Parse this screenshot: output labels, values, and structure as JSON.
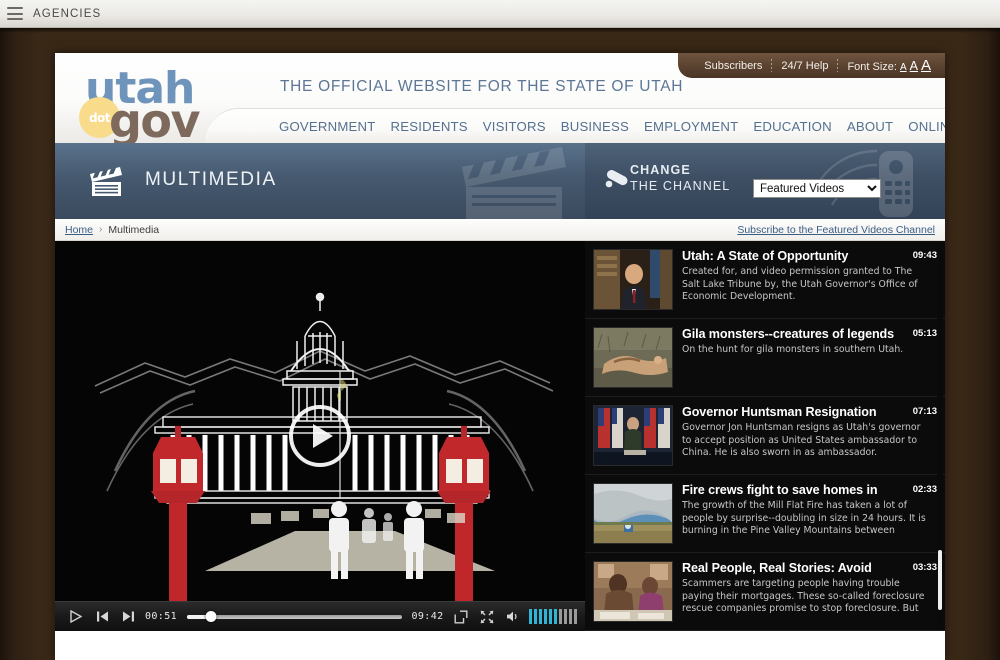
{
  "os_bar": {
    "menu_icon": "hamburger-icon",
    "agencies_label": "AGENCIES"
  },
  "header": {
    "logo": {
      "word1": "utah",
      "dot": "dot",
      "word2": "gov"
    },
    "tagline": "THE OFFICIAL WEBSITE FOR THE STATE OF UTAH",
    "utility": {
      "subscribers": "Subscribers",
      "help": "24/7 Help",
      "font_size_label": "Font Size:",
      "font_size_small": "A",
      "font_size_medium": "A",
      "font_size_large": "A"
    },
    "nav": [
      "GOVERNMENT",
      "RESIDENTS",
      "VISITORS",
      "BUSINESS",
      "EMPLOYMENT",
      "EDUCATION",
      "ABOUT",
      "ONLINE SERVICES"
    ]
  },
  "banner": {
    "section_icon": "clapperboard-icon",
    "section_title": "MULTIMEDIA",
    "channel_icon": "remote-control-icon",
    "channel_line1": "CHANGE",
    "channel_line2": "THE CHANNEL",
    "channel_selected": "Featured Videos",
    "channel_options": [
      "Featured Videos"
    ]
  },
  "breadcrumb": {
    "home": "Home",
    "separator": "›",
    "current": "Multimedia",
    "subscribe_link": "Subscribe to the Featured Videos Channel"
  },
  "player": {
    "poster_description": "Animated white line-art of the Utah State Capitol on black with red lamp posts and white figures",
    "play_icon": "play-icon",
    "controls": {
      "play": "play-icon",
      "previous": "previous-track-icon",
      "next": "next-track-icon",
      "current_time": "00:51",
      "total_time": "09:42",
      "progress_percent": 11,
      "popout": "popout-icon",
      "fullscreen": "fullscreen-icon",
      "mute": "speaker-icon",
      "volume_level": 6,
      "volume_max": 10
    }
  },
  "playlist": {
    "scroll_position": "near-bottom",
    "items": [
      {
        "title": "Utah: A State of Opportunity",
        "duration": "09:43",
        "description": "Created for, and video permission granted to The Salt Lake Tribune by, the Utah Governor's Office of Economic Development.",
        "thumb": "man-in-suit-speaking-at-desk"
      },
      {
        "title": "Gila monsters--creatures of legends",
        "duration": "05:13",
        "description": "On the hunt for gila monsters in southern Utah.",
        "thumb": "gila-monster-on-desert-ground"
      },
      {
        "title": "Governor Huntsman Resignation",
        "duration": "07:13",
        "description": "Governor Jon Huntsman resigns as Utah's governor to accept position as United States ambassador to China.  He is also sworn in as ambassador.",
        "thumb": "podium-with-american-flags"
      },
      {
        "title": "Fire crews fight to save homes in",
        "duration": "02:33",
        "description": "The growth of the Mill Flat Fire has taken a lot of people by surprise--doubling in size in 24 hours. It is burning in the Pine Valley Mountains between",
        "thumb": "wildfire-smoke-over-field"
      },
      {
        "title": "Real People, Real Stories: Avoid",
        "duration": "03:33",
        "description": "Scammers are targeting people having trouble paying their mortgages. These so-called foreclosure rescue companies promise to stop foreclosure. But",
        "thumb": "two-people-at-table-with-papers"
      }
    ]
  },
  "colors": {
    "page_background": "#3a2817",
    "logo_blue": "#6f94bb",
    "logo_gold": "#f8dc8c",
    "logo_brown": "#7d6a5c",
    "nav_link": "#56708f",
    "banner_blue": "#46596f",
    "utility_brown": "#5a4230",
    "link_blue": "#3a5d86",
    "volume_active": "#2fb6d6"
  }
}
